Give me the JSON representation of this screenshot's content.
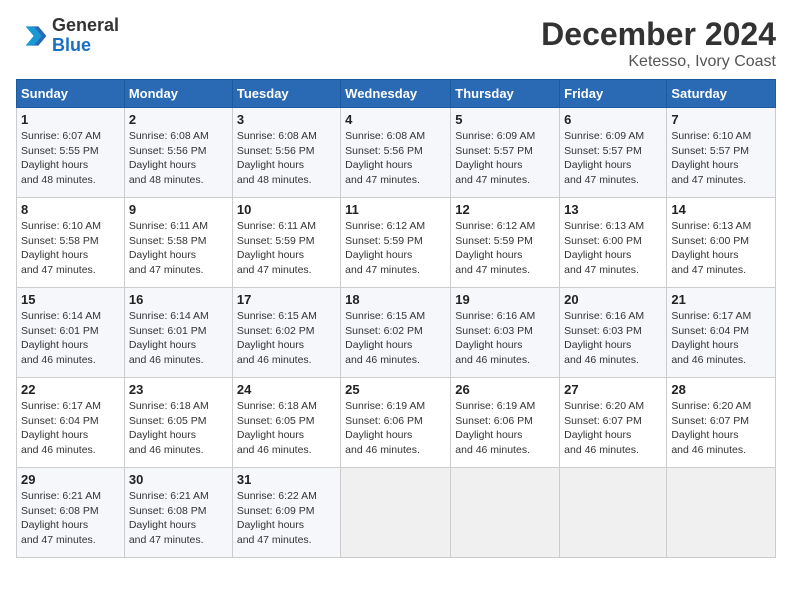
{
  "logo": {
    "general": "General",
    "blue": "Blue"
  },
  "title": "December 2024",
  "location": "Ketesso, Ivory Coast",
  "weekdays": [
    "Sunday",
    "Monday",
    "Tuesday",
    "Wednesday",
    "Thursday",
    "Friday",
    "Saturday"
  ],
  "weeks": [
    [
      {
        "day": "1",
        "sunrise": "6:07 AM",
        "sunset": "5:55 PM",
        "daylight": "11 hours and 48 minutes."
      },
      {
        "day": "2",
        "sunrise": "6:08 AM",
        "sunset": "5:56 PM",
        "daylight": "11 hours and 48 minutes."
      },
      {
        "day": "3",
        "sunrise": "6:08 AM",
        "sunset": "5:56 PM",
        "daylight": "11 hours and 48 minutes."
      },
      {
        "day": "4",
        "sunrise": "6:08 AM",
        "sunset": "5:56 PM",
        "daylight": "11 hours and 47 minutes."
      },
      {
        "day": "5",
        "sunrise": "6:09 AM",
        "sunset": "5:57 PM",
        "daylight": "11 hours and 47 minutes."
      },
      {
        "day": "6",
        "sunrise": "6:09 AM",
        "sunset": "5:57 PM",
        "daylight": "11 hours and 47 minutes."
      },
      {
        "day": "7",
        "sunrise": "6:10 AM",
        "sunset": "5:57 PM",
        "daylight": "11 hours and 47 minutes."
      }
    ],
    [
      {
        "day": "8",
        "sunrise": "6:10 AM",
        "sunset": "5:58 PM",
        "daylight": "11 hours and 47 minutes."
      },
      {
        "day": "9",
        "sunrise": "6:11 AM",
        "sunset": "5:58 PM",
        "daylight": "11 hours and 47 minutes."
      },
      {
        "day": "10",
        "sunrise": "6:11 AM",
        "sunset": "5:59 PM",
        "daylight": "11 hours and 47 minutes."
      },
      {
        "day": "11",
        "sunrise": "6:12 AM",
        "sunset": "5:59 PM",
        "daylight": "11 hours and 47 minutes."
      },
      {
        "day": "12",
        "sunrise": "6:12 AM",
        "sunset": "5:59 PM",
        "daylight": "11 hours and 47 minutes."
      },
      {
        "day": "13",
        "sunrise": "6:13 AM",
        "sunset": "6:00 PM",
        "daylight": "11 hours and 47 minutes."
      },
      {
        "day": "14",
        "sunrise": "6:13 AM",
        "sunset": "6:00 PM",
        "daylight": "11 hours and 47 minutes."
      }
    ],
    [
      {
        "day": "15",
        "sunrise": "6:14 AM",
        "sunset": "6:01 PM",
        "daylight": "11 hours and 46 minutes."
      },
      {
        "day": "16",
        "sunrise": "6:14 AM",
        "sunset": "6:01 PM",
        "daylight": "11 hours and 46 minutes."
      },
      {
        "day": "17",
        "sunrise": "6:15 AM",
        "sunset": "6:02 PM",
        "daylight": "11 hours and 46 minutes."
      },
      {
        "day": "18",
        "sunrise": "6:15 AM",
        "sunset": "6:02 PM",
        "daylight": "11 hours and 46 minutes."
      },
      {
        "day": "19",
        "sunrise": "6:16 AM",
        "sunset": "6:03 PM",
        "daylight": "11 hours and 46 minutes."
      },
      {
        "day": "20",
        "sunrise": "6:16 AM",
        "sunset": "6:03 PM",
        "daylight": "11 hours and 46 minutes."
      },
      {
        "day": "21",
        "sunrise": "6:17 AM",
        "sunset": "6:04 PM",
        "daylight": "11 hours and 46 minutes."
      }
    ],
    [
      {
        "day": "22",
        "sunrise": "6:17 AM",
        "sunset": "6:04 PM",
        "daylight": "11 hours and 46 minutes."
      },
      {
        "day": "23",
        "sunrise": "6:18 AM",
        "sunset": "6:05 PM",
        "daylight": "11 hours and 46 minutes."
      },
      {
        "day": "24",
        "sunrise": "6:18 AM",
        "sunset": "6:05 PM",
        "daylight": "11 hours and 46 minutes."
      },
      {
        "day": "25",
        "sunrise": "6:19 AM",
        "sunset": "6:06 PM",
        "daylight": "11 hours and 46 minutes."
      },
      {
        "day": "26",
        "sunrise": "6:19 AM",
        "sunset": "6:06 PM",
        "daylight": "11 hours and 46 minutes."
      },
      {
        "day": "27",
        "sunrise": "6:20 AM",
        "sunset": "6:07 PM",
        "daylight": "11 hours and 46 minutes."
      },
      {
        "day": "28",
        "sunrise": "6:20 AM",
        "sunset": "6:07 PM",
        "daylight": "11 hours and 46 minutes."
      }
    ],
    [
      {
        "day": "29",
        "sunrise": "6:21 AM",
        "sunset": "6:08 PM",
        "daylight": "11 hours and 47 minutes."
      },
      {
        "day": "30",
        "sunrise": "6:21 AM",
        "sunset": "6:08 PM",
        "daylight": "11 hours and 47 minutes."
      },
      {
        "day": "31",
        "sunrise": "6:22 AM",
        "sunset": "6:09 PM",
        "daylight": "11 hours and 47 minutes."
      },
      null,
      null,
      null,
      null
    ]
  ]
}
